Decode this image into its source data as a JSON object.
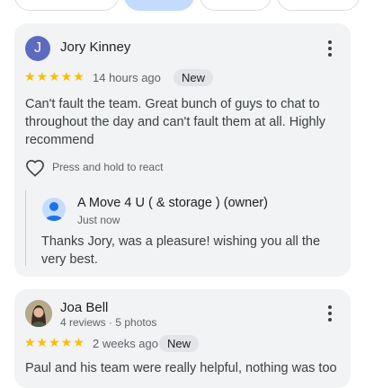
{
  "filter_chips": [
    {
      "label": ""
    },
    {
      "label": ""
    },
    {
      "label": ""
    },
    {
      "label": ""
    }
  ],
  "reviews": [
    {
      "avatar_letter": "J",
      "avatar_color": "#5c6bc0",
      "name": "Jory Kinney",
      "stars": "★★★★★",
      "rating": 5,
      "time": "14 hours ago",
      "badge": "New",
      "text": "Can't fault the team. Great bunch of guys to chat to throughout the day and can't fault them at all. Highly recommend",
      "react_label": "Press and hold to react",
      "owner_reply": {
        "name": "A Move 4 U ( & storage ) (owner)",
        "time": "Just now",
        "text": "Thanks Jory, was a pleasure! wishing you all the very best."
      }
    },
    {
      "name": "Joa Bell",
      "meta": "4 reviews · 5 photos",
      "stars": "★★★★★",
      "rating": 5,
      "time": "2 weeks ago",
      "badge": "New",
      "text": "Paul and his team were really helpful, nothing was too"
    }
  ],
  "icons": {
    "more": "more-vert-icon",
    "heart": "heart-outline-icon",
    "owner_avatar": "person-icon"
  },
  "colors": {
    "star": "#fbbc04",
    "card_bg": "#f1f3f4",
    "selected_chip": "#c2dbff"
  }
}
